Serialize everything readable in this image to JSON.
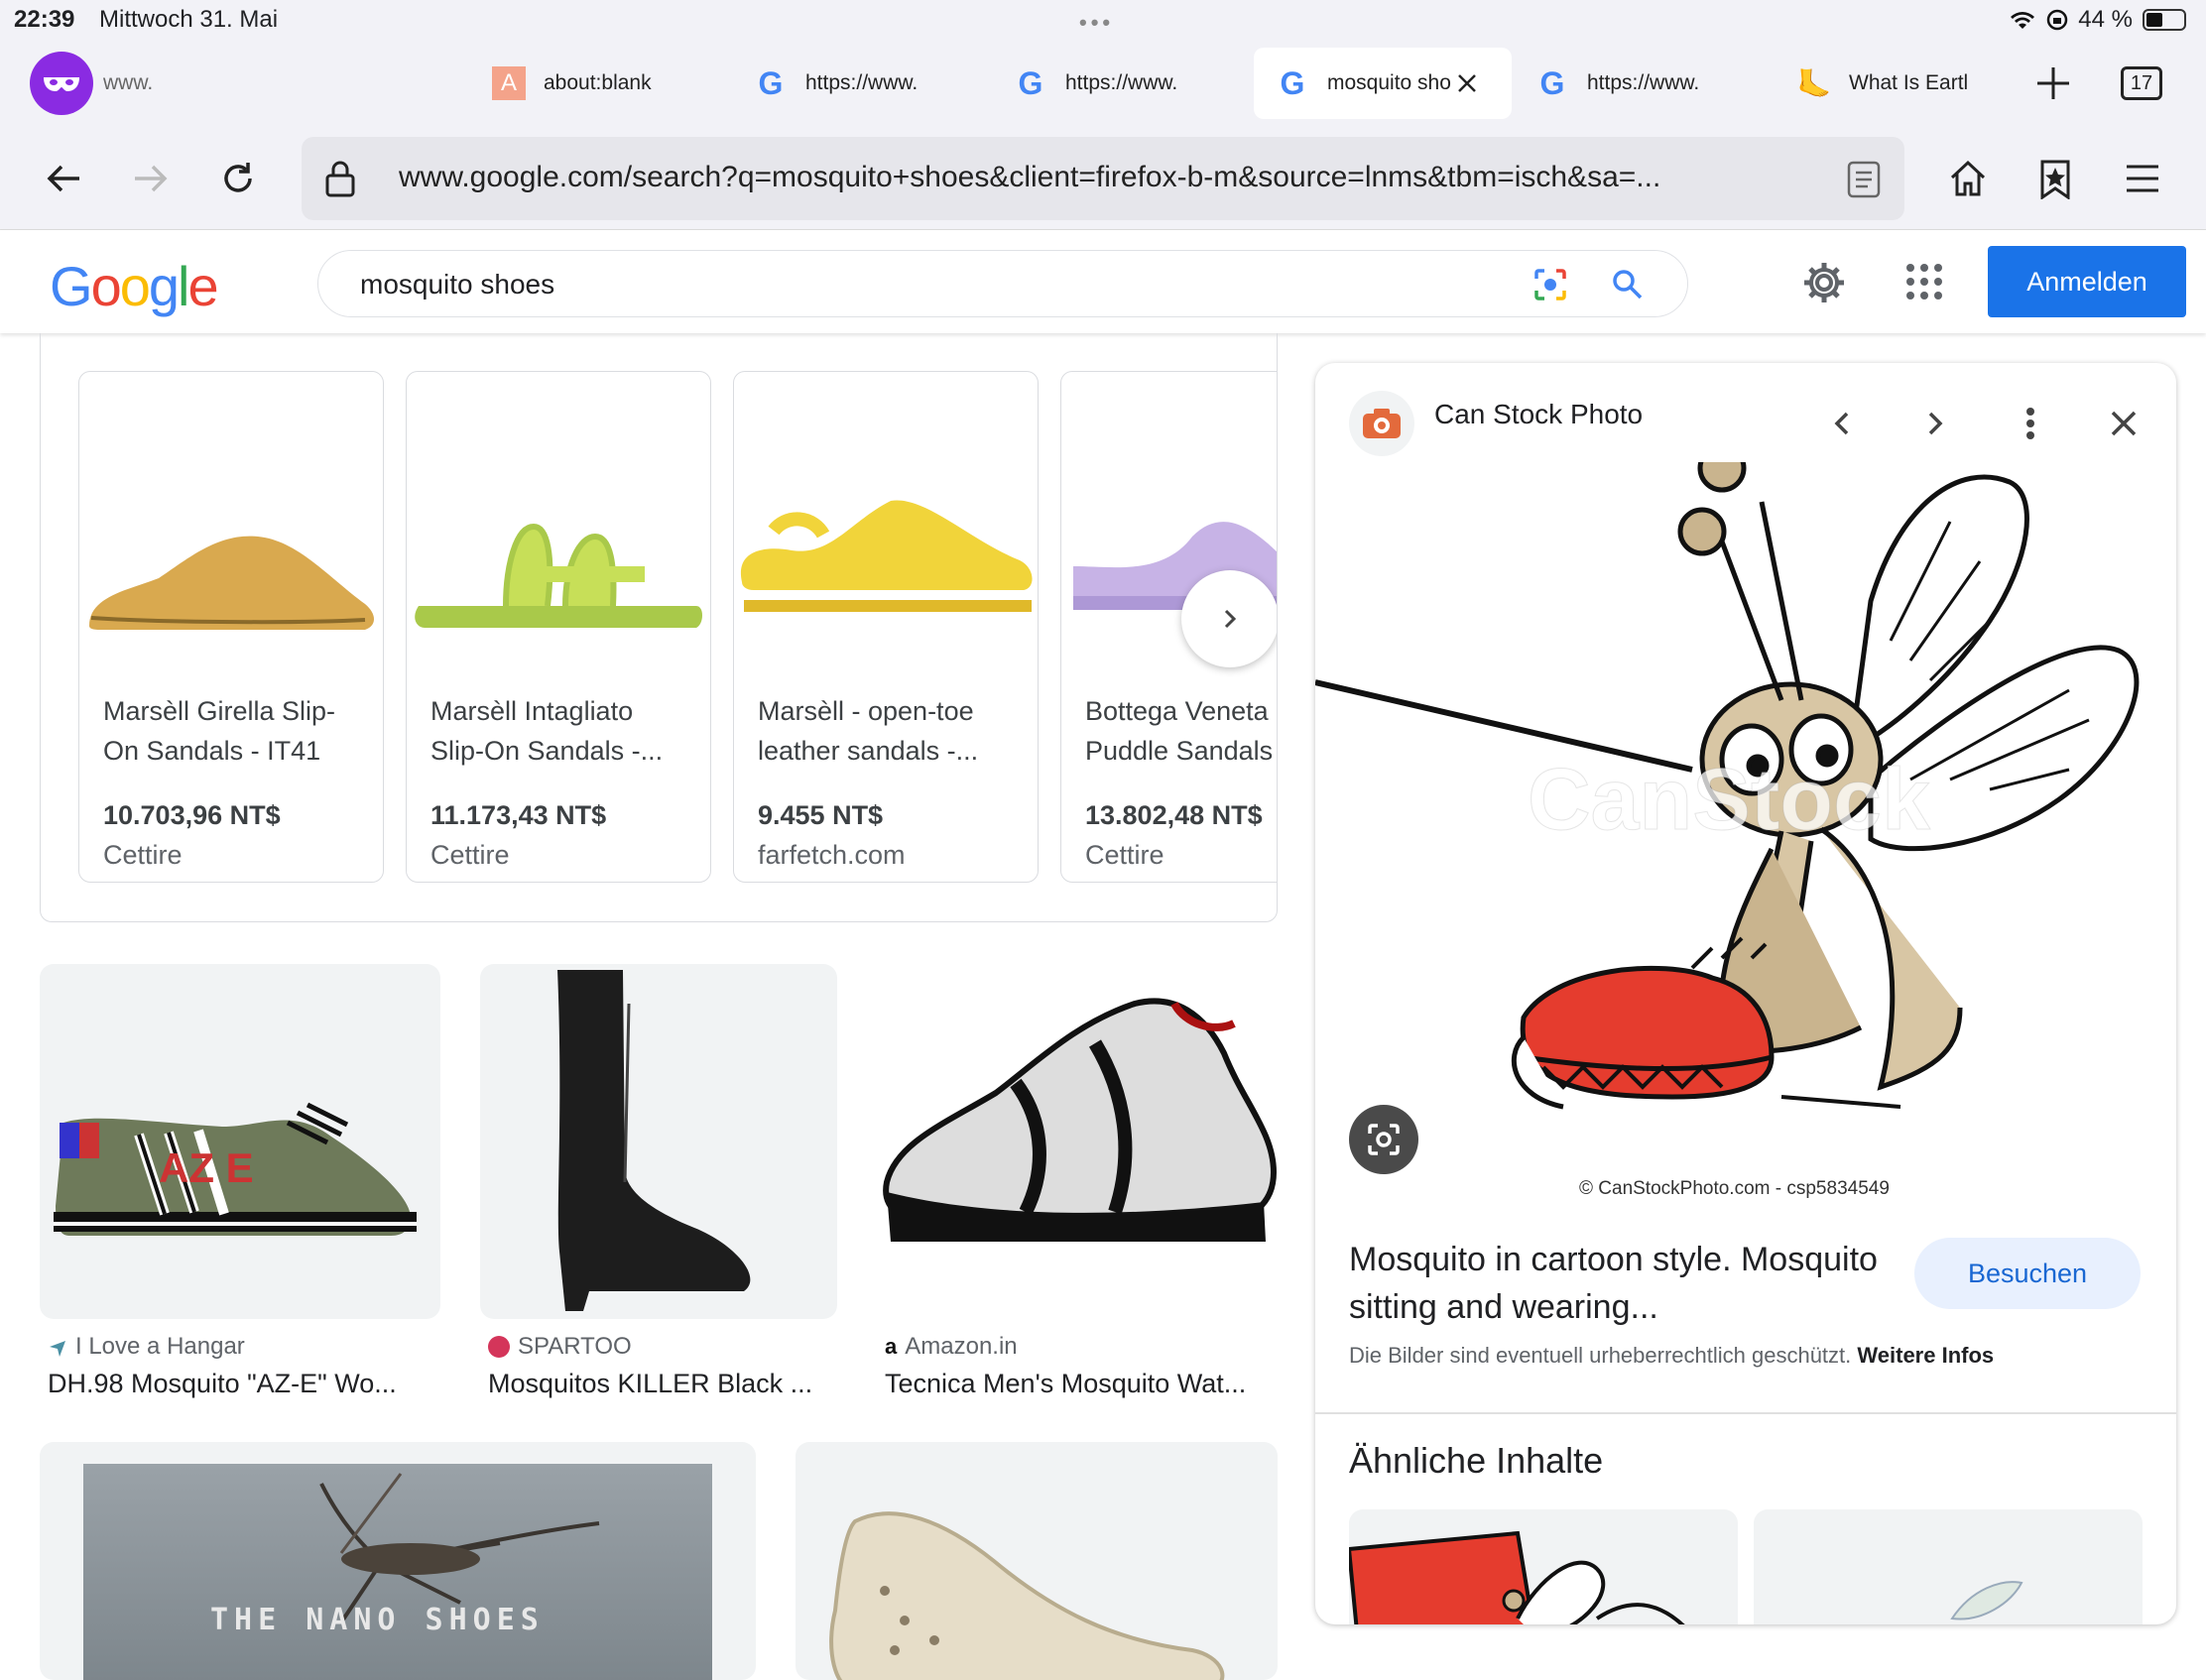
{
  "status_bar": {
    "time": "22:39",
    "date": "Mittwoch 31. Mai",
    "battery": "44 %"
  },
  "tabs": [
    {
      "label": "www."
    },
    {
      "label": "about:blank"
    },
    {
      "label": "https://www."
    },
    {
      "label": "https://www."
    },
    {
      "label": "mosquito sho"
    },
    {
      "label": "https://www."
    },
    {
      "label": "What Is Eartl"
    }
  ],
  "tab_count": "17",
  "url": "www.google.com/search?q=mosquito+shoes&client=firefox-b-m&source=lnms&tbm=isch&sa=...",
  "search": {
    "query": "mosquito shoes"
  },
  "header": {
    "signin_label": "Anmelden"
  },
  "products": [
    {
      "title": "Marsèll Girella Slip-\nOn Sandals - IT41",
      "price": "10.703,96 NT$",
      "store": "Cettire"
    },
    {
      "title": "Marsèll Intagliato\nSlip-On Sandals -...",
      "price": "11.173,43 NT$",
      "store": "Cettire"
    },
    {
      "title": "Marsèll - open-toe\nleather sandals -...",
      "price": "9.455 NT$",
      "store": "farfetch.com"
    },
    {
      "title": "Bottega Veneta\nPuddle Sandals",
      "price": "13.802,48 NT$",
      "store": "Cettire"
    }
  ],
  "results": [
    {
      "source": "I Love a Hangar",
      "title": "DH.98 Mosquito \"AZ-E\" Wo..."
    },
    {
      "source": "SPARTOO",
      "title": "Mosquitos KILLER Black ..."
    },
    {
      "source": "Amazon.in",
      "title": "Tecnica Men's Mosquito Wat..."
    }
  ],
  "nano_text": "THE NANO SHOES",
  "panel": {
    "source": "Can Stock Photo",
    "watermark": "CanStock",
    "credit": "© CanStockPhoto.com - csp5834549",
    "caption": "Mosquito in cartoon style. Mosquito sitting and wearing...",
    "visit_label": "Besuchen",
    "rights_text": "Die Bilder sind eventuell urheberrechtlich geschützt.",
    "rights_link": "Weitere Infos",
    "similar_title": "Ähnliche Inhalte"
  }
}
